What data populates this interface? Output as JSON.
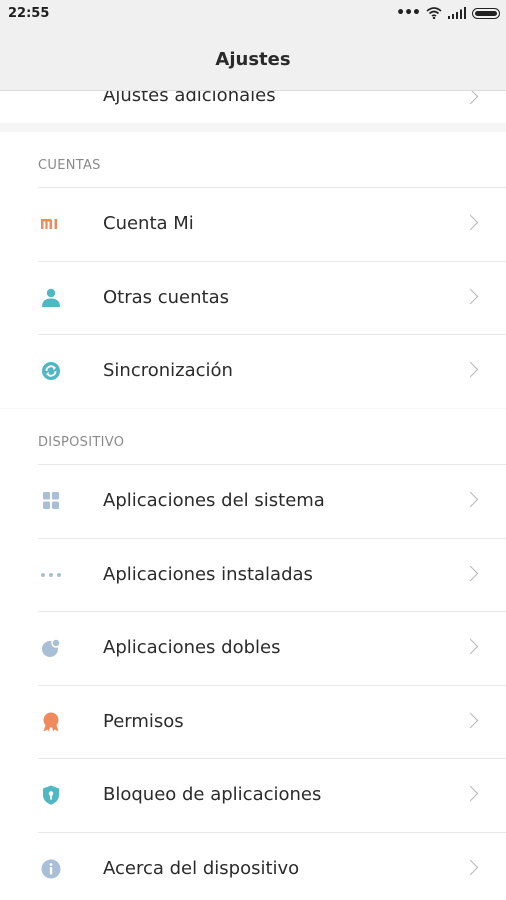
{
  "status_bar": {
    "time": "22:55",
    "icons": [
      "more-dots-icon",
      "wifi-icon",
      "signal-icon",
      "battery-icon"
    ]
  },
  "header": {
    "title": "Ajustes"
  },
  "partial_item": {
    "label": "Ajustes adicionales",
    "icon": "more-settings-icon"
  },
  "sections": [
    {
      "title": "CUENTAS",
      "items": [
        {
          "label": "Cuenta Mi",
          "icon": "mi-account-icon",
          "color": "#f08a5d"
        },
        {
          "label": "Otras cuentas",
          "icon": "user-icon",
          "color": "#4fb8c4"
        },
        {
          "label": "Sincronización",
          "icon": "sync-icon",
          "color": "#4fb8c4"
        }
      ]
    },
    {
      "title": "DISPOSITIVO",
      "items": [
        {
          "label": "Aplicaciones del sistema",
          "icon": "grid-apps-icon",
          "color": "#a9bfd8"
        },
        {
          "label": "Aplicaciones instaladas",
          "icon": "dots-apps-icon",
          "color": "#a9bfd8"
        },
        {
          "label": "Aplicaciones dobles",
          "icon": "dual-apps-icon",
          "color": "#a9bfd8"
        },
        {
          "label": "Permisos",
          "icon": "permissions-badge-icon",
          "color": "#f08a5d"
        },
        {
          "label": "Bloqueo de aplicaciones",
          "icon": "app-lock-shield-icon",
          "color": "#4fb8c4"
        },
        {
          "label": "Acerca del dispositivo",
          "icon": "info-icon",
          "color": "#a9bfd8"
        }
      ]
    }
  ]
}
